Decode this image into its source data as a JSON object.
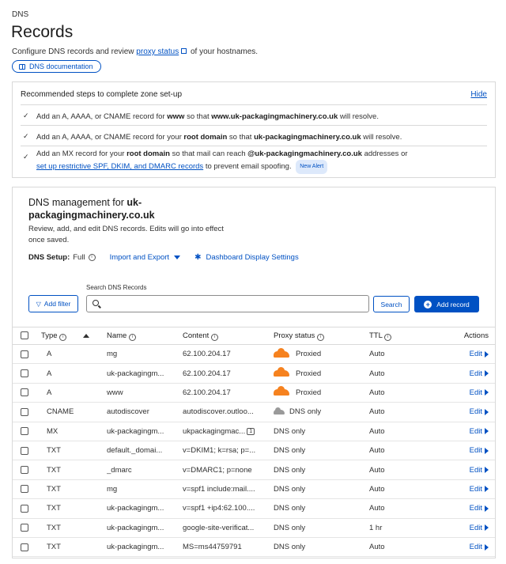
{
  "header": {
    "eyebrow": "DNS",
    "title": "Records",
    "description_pre": "Configure DNS records and review",
    "proxy_status_link": "proxy status",
    "description_post": "of your hostnames.",
    "doc_button": "DNS documentation"
  },
  "steps": {
    "title": "Recommended steps to complete zone set-up",
    "hide_label": "Hide",
    "items": [
      {
        "pre": "Add an A, AAAA, or CNAME record for",
        "bold1": "www",
        "mid": "so that",
        "bold2": "www.uk-packagingmachinery.co.uk",
        "post": "will resolve."
      },
      {
        "pre": "Add an A, AAAA, or CNAME record for your",
        "bold1": "root domain",
        "mid": "so that",
        "bold2": "uk-packagingmachinery.co.uk",
        "post": "will resolve."
      },
      {
        "pre": "Add an MX record for your",
        "bold1": "root domain",
        "mid": "so that mail can reach",
        "bold2": "@uk-packagingmachinery.co.uk",
        "post": "addresses or",
        "link": "set up restrictive SPF, DKIM, and DMARC records",
        "post2": "to prevent email spoofing.",
        "badge": "New Alert"
      }
    ]
  },
  "mgmt": {
    "title_pre": "DNS management for",
    "title_domain": "uk-packagingmachinery.co.uk",
    "description": "Review, add, and edit DNS records. Edits will go into effect once saved.",
    "setup_label": "DNS Setup:",
    "setup_value": "Full",
    "import_export": "Import and Export",
    "dashboard_settings": "Dashboard Display Settings",
    "search_label": "Search DNS Records",
    "search_placeholder": "",
    "add_filter": "Add filter",
    "search_button": "Search",
    "add_record": "Add record"
  },
  "table": {
    "headers": {
      "type": "Type",
      "name": "Name",
      "content": "Content",
      "proxy": "Proxy status",
      "ttl": "TTL",
      "actions": "Actions"
    },
    "edit_label": "Edit",
    "rows": [
      {
        "warn": false,
        "type": "A",
        "name": "mg",
        "content": "62.100.204.17",
        "badge": "",
        "proxy": "Proxied",
        "cloud": "orange",
        "ttl": "Auto"
      },
      {
        "warn": false,
        "type": "A",
        "name": "uk-packagingm...",
        "content": "62.100.204.17",
        "badge": "",
        "proxy": "Proxied",
        "cloud": "orange",
        "ttl": "Auto"
      },
      {
        "warn": false,
        "type": "A",
        "name": "www",
        "content": "62.100.204.17",
        "badge": "",
        "proxy": "Proxied",
        "cloud": "orange",
        "ttl": "Auto"
      },
      {
        "warn": false,
        "type": "CNAME",
        "name": "autodiscover",
        "content": "autodiscover.outloo...",
        "badge": "",
        "proxy": "DNS only",
        "cloud": "grey",
        "ttl": "Auto"
      },
      {
        "warn": false,
        "type": "MX",
        "name": "uk-packagingm...",
        "content": "ukpackagingmac...",
        "badge": "1",
        "proxy": "DNS only",
        "cloud": "none",
        "ttl": "Auto"
      },
      {
        "warn": true,
        "type": "TXT",
        "name": "default._domai...",
        "content": "v=DKIM1; k=rsa; p=...",
        "badge": "",
        "proxy": "DNS only",
        "cloud": "none",
        "ttl": "Auto"
      },
      {
        "warn": true,
        "type": "TXT",
        "name": "_dmarc",
        "content": "v=DMARC1; p=none",
        "badge": "",
        "proxy": "DNS only",
        "cloud": "none",
        "ttl": "Auto"
      },
      {
        "warn": true,
        "type": "TXT",
        "name": "mg",
        "content": "v=spf1 include:mail....",
        "badge": "",
        "proxy": "DNS only",
        "cloud": "none",
        "ttl": "Auto"
      },
      {
        "warn": true,
        "type": "TXT",
        "name": "uk-packagingm...",
        "content": "v=spf1 +ip4:62.100....",
        "badge": "",
        "proxy": "DNS only",
        "cloud": "none",
        "ttl": "Auto"
      },
      {
        "warn": true,
        "type": "TXT",
        "name": "uk-packagingm...",
        "content": "google-site-verificat...",
        "badge": "",
        "proxy": "DNS only",
        "cloud": "none",
        "ttl": "1 hr"
      },
      {
        "warn": true,
        "type": "TXT",
        "name": "uk-packagingm...",
        "content": "MS=ms44759791",
        "badge": "",
        "proxy": "DNS only",
        "cloud": "none",
        "ttl": "Auto"
      }
    ]
  },
  "colors": {
    "accent": "#0051c3",
    "proxied_cloud": "#f6821f",
    "dnsonly_cloud": "#9a9a9a",
    "warning": "#b96d00"
  }
}
